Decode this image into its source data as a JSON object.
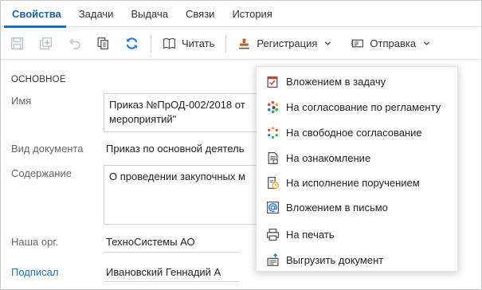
{
  "tabs": [
    {
      "label": "Свойства",
      "active": true
    },
    {
      "label": "Задачи",
      "active": false
    },
    {
      "label": "Выдача",
      "active": false
    },
    {
      "label": "Связи",
      "active": false
    },
    {
      "label": "История",
      "active": false
    }
  ],
  "toolbar": {
    "read_label": "Читать",
    "registration_label": "Регистрация",
    "send_label": "Отправка"
  },
  "form": {
    "section_title": "ОСНОВНОЕ",
    "name_label": "Имя",
    "name_value_line1": "Приказ №ПрОД-002/2018 от",
    "name_value_line2": "мероприятий\"",
    "doctype_label": "Вид документа",
    "doctype_value": "Приказ по основной деятель",
    "content_label": "Содержание",
    "content_value": "О проведении закупочных м",
    "org_label": "Наша орг.",
    "org_value": "ТехноСистемы АО",
    "signed_label": "Подписал",
    "signed_value": "Ивановский Геннадий А"
  },
  "send_menu": {
    "items": [
      {
        "label": "Вложением в задачу",
        "icon": "task-checkbox-icon"
      },
      {
        "label": "На согласование по регламенту",
        "icon": "approval-regulation-icon"
      },
      {
        "label": "На свободное согласование",
        "icon": "free-approval-icon"
      },
      {
        "label": "На ознакомление",
        "icon": "familiarization-icon"
      },
      {
        "label": "На исполнение поручением",
        "icon": "execution-order-icon"
      },
      {
        "label": "Вложением в письмо",
        "icon": "email-at-icon"
      },
      {
        "label": "На печать",
        "icon": "printer-icon"
      },
      {
        "label": "Выгрузить документ",
        "icon": "export-document-icon"
      }
    ]
  },
  "colors": {
    "accent": "#1f6fc5",
    "refresh_icon": "#1f7fd6",
    "stamp_icon": "#b5652a"
  }
}
